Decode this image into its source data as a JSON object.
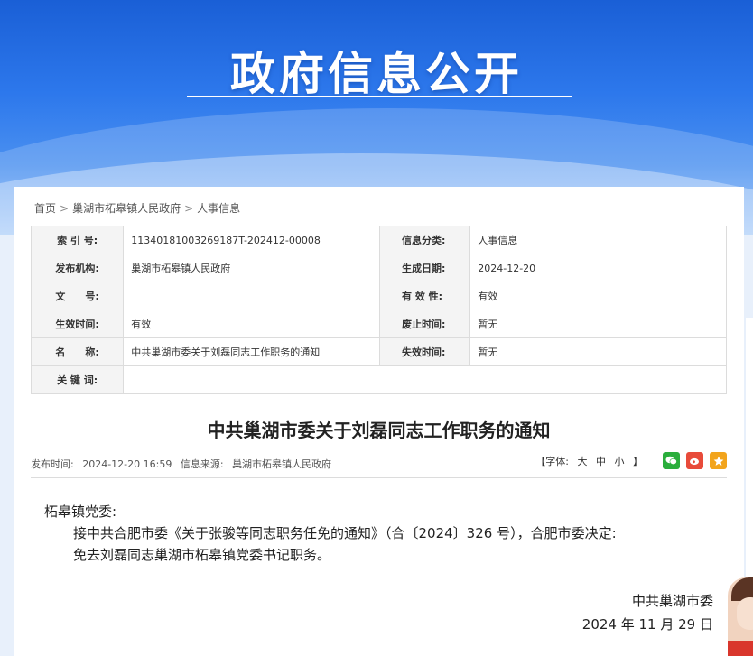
{
  "banner": {
    "title": "政府信息公开"
  },
  "breadcrumb": [
    "首页",
    "巢湖市柘皋镇人民政府",
    "人事信息"
  ],
  "breadcrumb_sep": ">",
  "meta": {
    "rows": [
      {
        "l1": "索 引 号:",
        "v1": "11340181003269187T-202412-00008",
        "l2": "信息分类:",
        "v2": "人事信息"
      },
      {
        "l1": "发布机构:",
        "v1": "巢湖市柘皋镇人民政府",
        "l2": "生成日期:",
        "v2": "2024-12-20"
      },
      {
        "l1": "文　　号:",
        "v1": "",
        "l2": "有 效 性:",
        "v2": "有效"
      },
      {
        "l1": "生效时间:",
        "v1": "有效",
        "l2": "废止时间:",
        "v2": "暂无"
      },
      {
        "l1": "名　　称:",
        "v1": "中共巢湖市委关于刘磊同志工作职务的通知",
        "l2": "失效时间:",
        "v2": "暂无"
      },
      {
        "l1": "关 键 词:",
        "v1": ""
      }
    ]
  },
  "doc": {
    "title": "中共巢湖市委关于刘磊同志工作职务的通知",
    "publish_label": "发布时间:",
    "publish_time": "2024-12-20 16:59",
    "source_label": "信息来源:",
    "source": "巢湖市柘皋镇人民政府",
    "font_open": "【字体:",
    "font_large": "大",
    "font_medium": "中",
    "font_small": "小",
    "font_close": "】",
    "salutation": "柘皋镇党委:",
    "para1": "接中共合肥市委《关于张骏等同志职务任免的通知》（合〔2024〕326 号），合肥市委决定:",
    "para2": "免去刘磊同志巢湖市柘皋镇党委书记职务。",
    "sign_org": "中共巢湖市委",
    "sign_date": "2024 年 11 月 29 日"
  },
  "share": {
    "wechat_icon": "wechat-icon",
    "weibo_icon": "weibo-icon",
    "qzone_icon": "qzone-icon"
  }
}
